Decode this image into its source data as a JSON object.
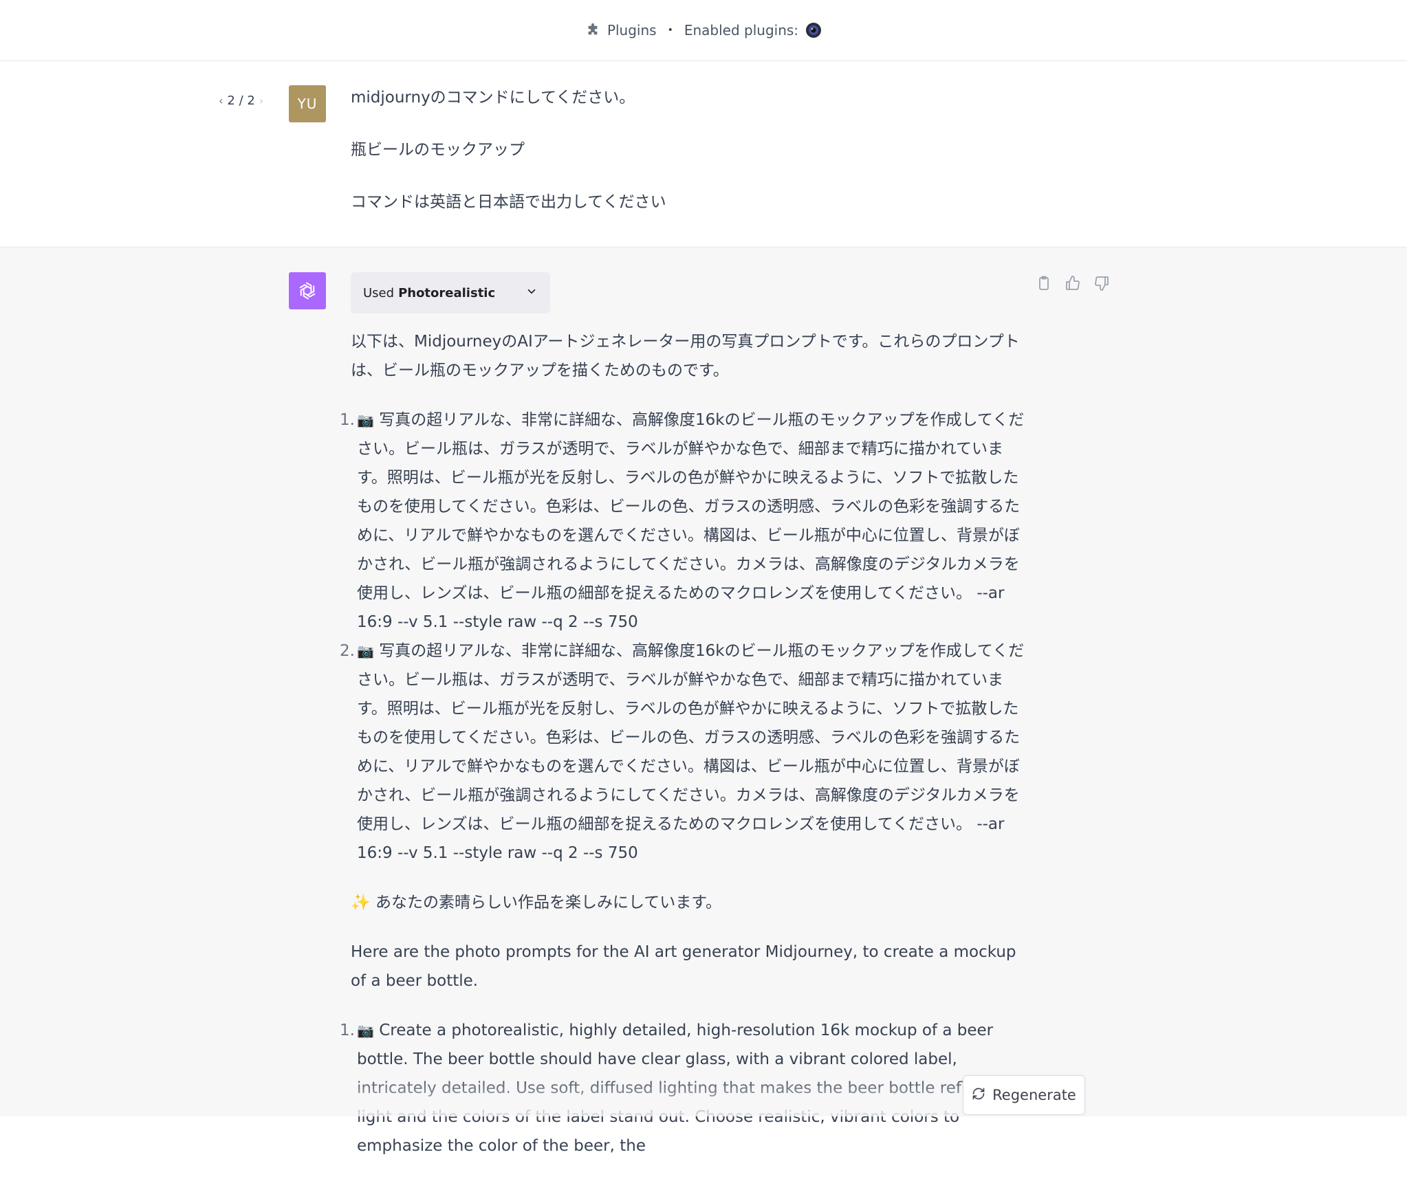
{
  "header": {
    "plugins_label": "Plugins",
    "separator": "•",
    "enabled_label": "Enabled plugins:"
  },
  "pager": {
    "text": "2 / 2",
    "prev": "‹",
    "next": "›"
  },
  "user": {
    "avatar_initials": "YU",
    "avatar_color": "#ad9660",
    "lines": [
      "midjournyのコマンドにしてください。",
      "瓶ビールのモックアップ",
      "コマンドは英語と日本語で出力してください"
    ]
  },
  "assistant": {
    "avatar_color": "#ab68ff",
    "used_prefix": "Used",
    "used_plugin": "Photorealistic",
    "intro": "以下は、MidjourneyのAIアートジェネレーター用の写真プロンプトです。これらのプロンプトは、ビール瓶のモックアップを描くためのものです。",
    "jp_items": [
      {
        "num": "1.",
        "icon": "📷",
        "text": "写真の超リアルな、非常に詳細な、高解像度16kのビール瓶のモックアップを作成してください。ビール瓶は、ガラスが透明で、ラベルが鮮やかな色で、細部まで精巧に描かれています。照明は、ビール瓶が光を反射し、ラベルの色が鮮やかに映えるように、ソフトで拡散したものを使用してください。色彩は、ビールの色、ガラスの透明感、ラベルの色彩を強調するために、リアルで鮮やかなものを選んでください。構図は、ビール瓶が中心に位置し、背景がぼかされ、ビール瓶が強調されるようにしてください。カメラは、高解像度のデジタルカメラを使用し、レンズは、ビール瓶の細部を捉えるためのマクロレンズを使用してください。 --ar 16:9 --v 5.1 --style raw --q 2 --s 750"
      },
      {
        "num": "2.",
        "icon": "📷",
        "text": "写真の超リアルな、非常に詳細な、高解像度16kのビール瓶のモックアップを作成してください。ビール瓶は、ガラスが透明で、ラベルが鮮やかな色で、細部まで精巧に描かれています。照明は、ビール瓶が光を反射し、ラベルの色が鮮やかに映えるように、ソフトで拡散したものを使用してください。色彩は、ビールの色、ガラスの透明感、ラベルの色彩を強調するために、リアルで鮮やかなものを選んでください。構図は、ビール瓶が中心に位置し、背景がぼかされ、ビール瓶が強調されるようにしてください。カメラは、高解像度のデジタルカメラを使用し、レンズは、ビール瓶の細部を捉えるためのマクロレンズを使用してください。 --ar 16:9 --v 5.1 --style raw --q 2 --s 750"
      }
    ],
    "sparkle_icon": "✨",
    "closing_jp": "あなたの素晴らしい作品を楽しみにしています。",
    "intro_en": "Here are the photo prompts for the AI art generator Midjourney, to create a mockup of a beer bottle.",
    "en_items": [
      {
        "num": "1.",
        "icon": "📷",
        "text": "Create a photorealistic, highly detailed, high-resolution 16k mockup of a beer bottle. The beer bottle should have clear glass, with a vibrant colored label, intricately detailed. Use soft, diffused lighting that makes the beer bottle reflect light and the colors of the label stand out. Choose realistic, vibrant colors to emphasize the color of the beer, the"
      }
    ]
  },
  "regenerate_label": "Regenerate"
}
